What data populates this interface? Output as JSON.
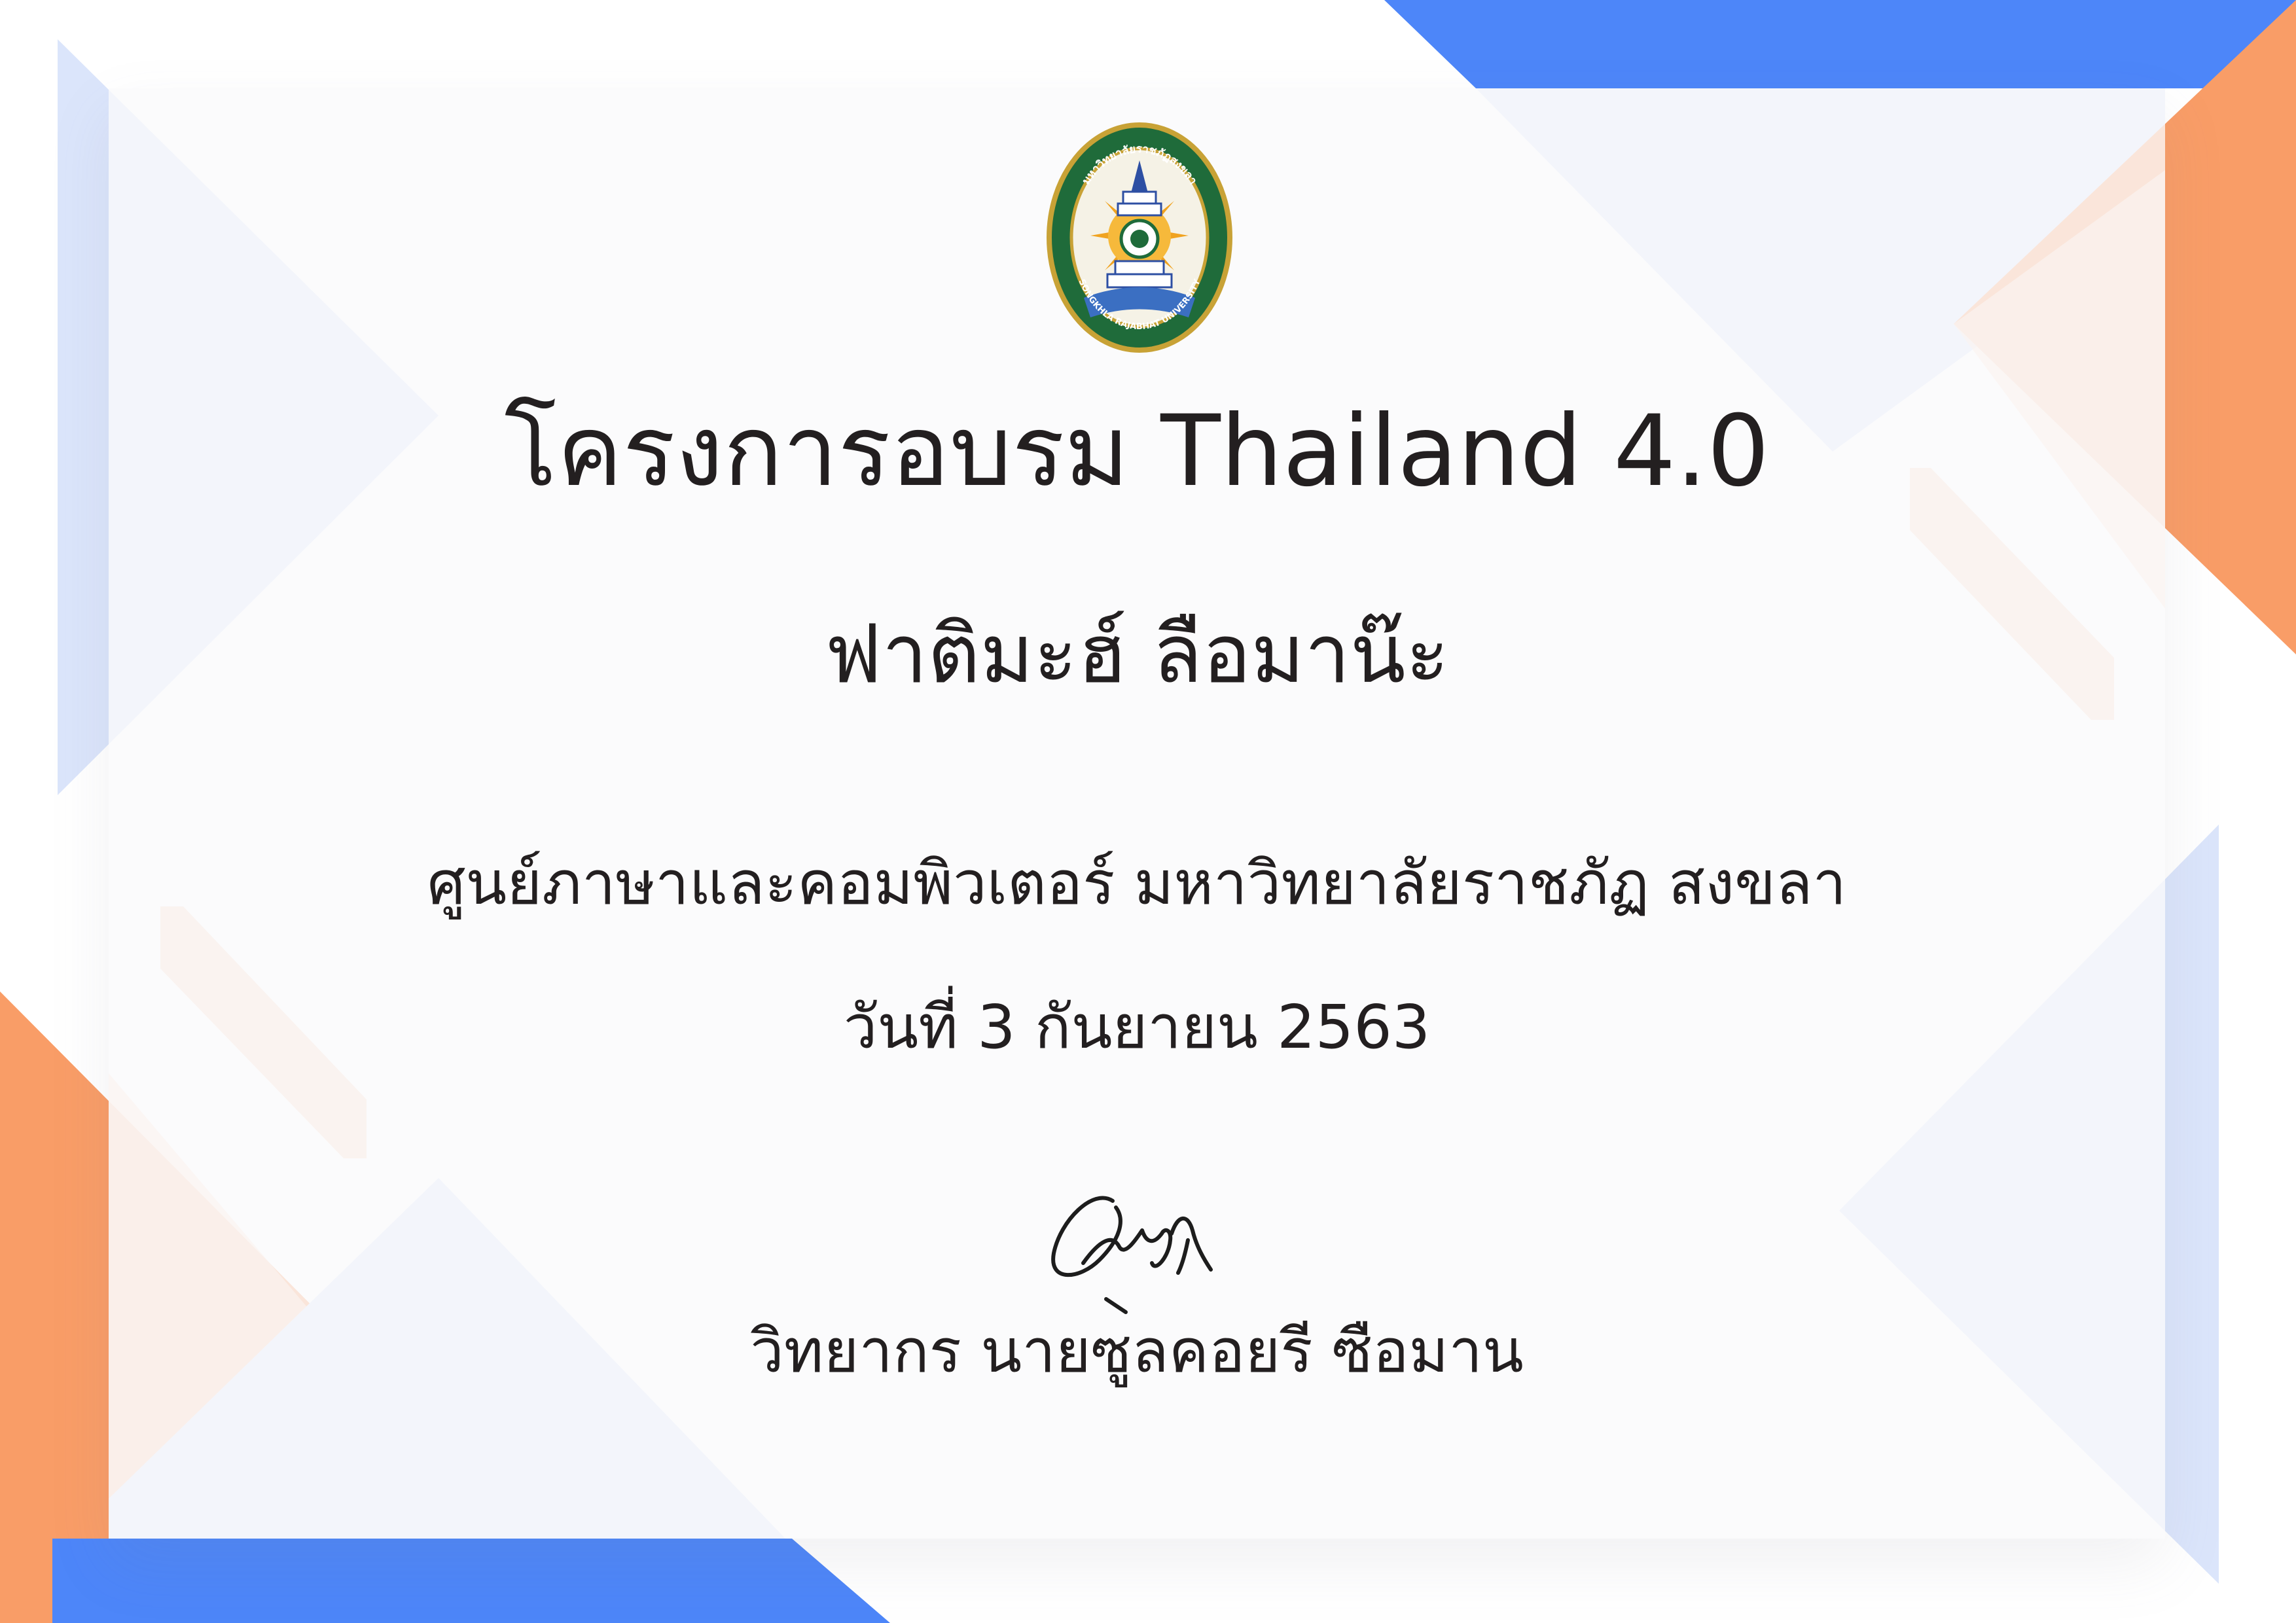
{
  "certificate": {
    "title": "โครงการอบรม Thailand 4.0",
    "recipient_name": "ฟาติมะฮ์  ลือมาน๊ะ",
    "organization": "ศูนย์ภาษาและคอมพิวเตอร์ มหาวิทยาลัยราชภัฏ สงขลา",
    "date": "วันที่ 3 กันยายน 2563",
    "lecturer": "วิทยากร นายซูลคอยรี ซือมาน"
  },
  "logo": {
    "top_text": "มหาวิทยาลัยราชภัฏสงขลา",
    "bottom_text": "SONGKHLA RAJABHAT UNIVERSITY",
    "icon": "university-seal-icon"
  },
  "signature": {
    "icon": "handwritten-signature-icon"
  },
  "colors": {
    "blue": "#4d86f9",
    "light_blue": "#dbe5fb",
    "orange": "#f99d67",
    "peach": "#fbdcc9",
    "text": "#231f20",
    "seal_green": "#1f6b3a"
  }
}
